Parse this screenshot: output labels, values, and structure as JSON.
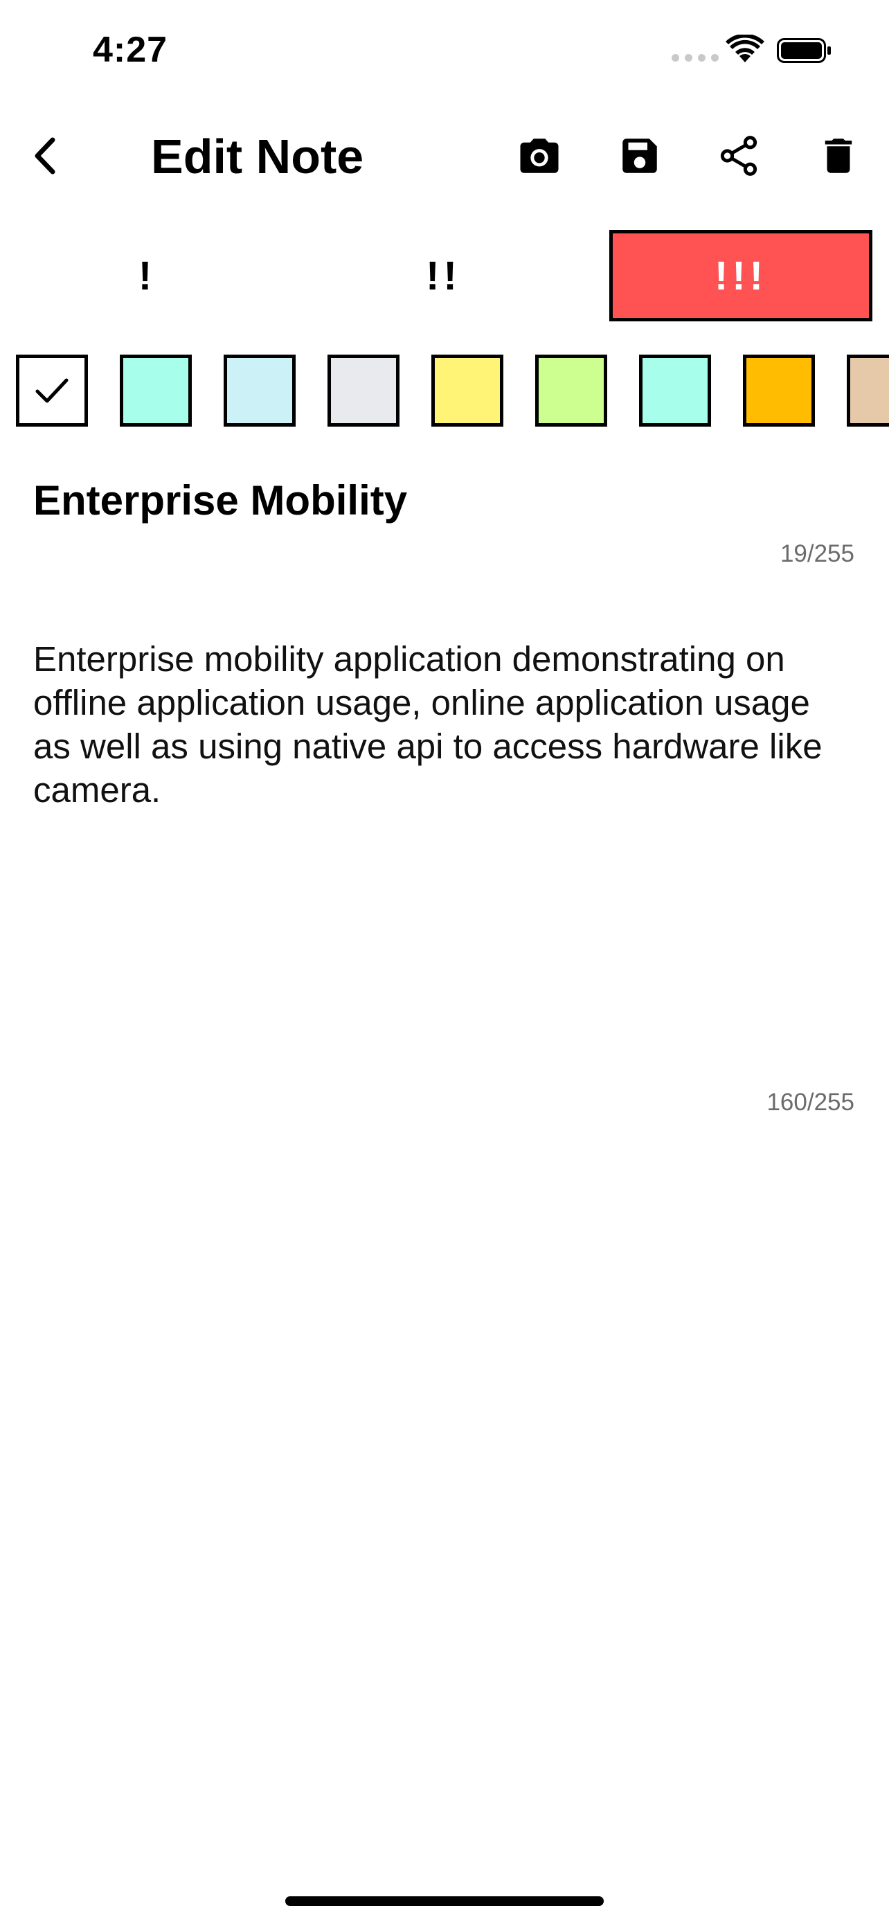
{
  "status_bar": {
    "time": "4:27",
    "icons": [
      "cellular-signal-icon",
      "wifi-icon",
      "battery-icon"
    ]
  },
  "app_bar": {
    "title": "Edit Note",
    "actions": [
      "camera-icon",
      "save-icon",
      "share-icon",
      "delete-icon"
    ]
  },
  "priority": {
    "options": [
      "!",
      "!!",
      "!!!"
    ],
    "selected": "!!!",
    "selected_color": "#FF5252"
  },
  "colors": {
    "swatches": [
      "#FFFFFF",
      "#A7FFEB",
      "#CCF2F8",
      "#E9EAEE",
      "#FFF475",
      "#CCFF90",
      "#A7FFEB",
      "#FFBC00",
      "#E6C9A8"
    ],
    "selected": "#FFFFFF"
  },
  "note": {
    "title": "Enterprise Mobility",
    "title_counter": "19/255",
    "body": "Enterprise mobility application demonstrating on offline application usage, online application usage as well as using native api to access hardware like camera.",
    "body_counter": "160/255"
  }
}
